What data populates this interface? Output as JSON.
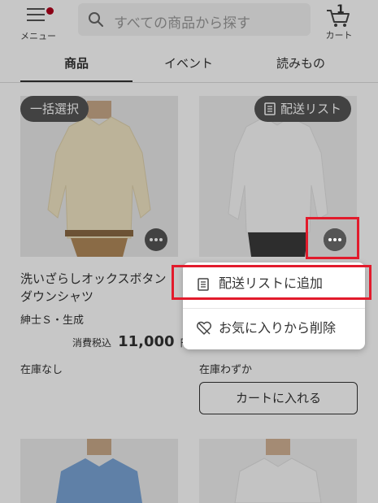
{
  "header": {
    "menu_label": "メニュー",
    "search_placeholder": "すべての商品から探す",
    "cart_count": "1",
    "cart_label": "カート"
  },
  "tabs": [
    {
      "label": "商品",
      "active": true
    },
    {
      "label": "イベント",
      "active": false
    },
    {
      "label": "読みもの",
      "active": false
    }
  ],
  "products": [
    {
      "select_badge": "一括選択",
      "name_line1": "洗いざらしオックスボタン",
      "name_line2": "ダウンシャツ",
      "variant": "紳士Ｓ・生成",
      "price_prefix": "消費税込",
      "price": "11,000",
      "price_unit": "円",
      "stock": "在庫なし"
    },
    {
      "delivery_badge": "配送リスト",
      "stock": "在庫わずか",
      "cart_button": "カートに入れる"
    }
  ],
  "context_menu": {
    "add_delivery_list": "配送リストに追加",
    "remove_favorite": "お気に入りから削除"
  },
  "colors": {
    "highlight": "#e21b2c",
    "notification_dot": "#b3001b"
  }
}
